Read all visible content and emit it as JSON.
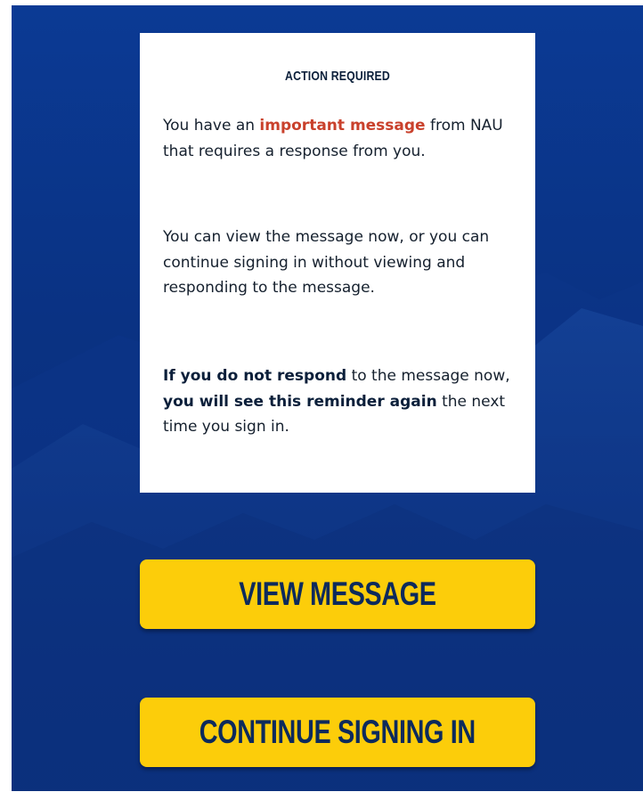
{
  "notice": {
    "heading": "ACTION REQUIRED",
    "p1": {
      "before": "You have an ",
      "highlight": "important message",
      "after": " from NAU that requires a response from you."
    },
    "p2": "You can view the message now, or you can continue signing in without viewing and responding to the message.",
    "p3": {
      "bold1": "If you do not respond",
      "mid1": " to the message now, ",
      "bold2": "you will see this reminder again",
      "end": " the next time you sign in."
    }
  },
  "actions": {
    "view_label": "VIEW MESSAGE",
    "continue_label": "CONTINUE SIGNING IN"
  },
  "colors": {
    "background": "#0a3283",
    "card": "#ffffff",
    "highlight": "#c9412c",
    "button": "#fccd0a",
    "button_text": "#0c2a5c"
  }
}
